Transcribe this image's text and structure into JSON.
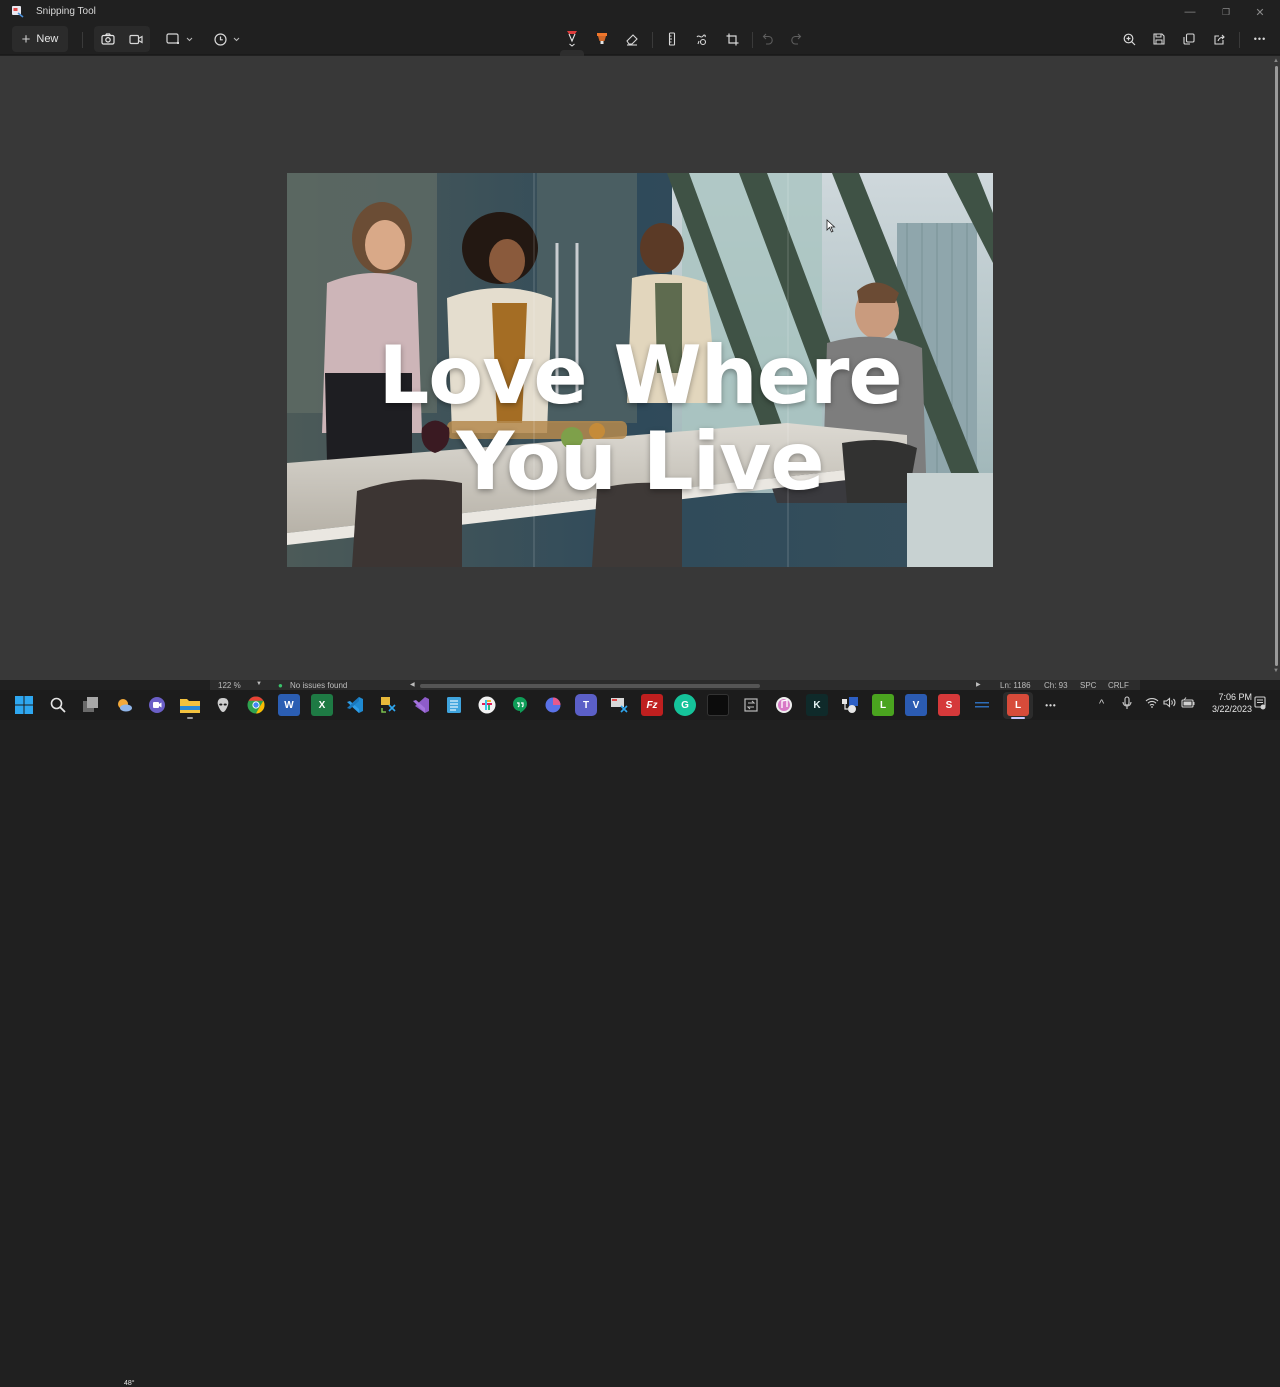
{
  "window": {
    "title": "Snipping Tool",
    "controls": {
      "minimize": "—",
      "maximize": "❐",
      "close": "✕"
    }
  },
  "toolbar": {
    "new_label": "New",
    "new_icon": "plus-icon",
    "capture_modes": [
      {
        "name": "snip-mode",
        "icon": "camera-icon",
        "active": true
      },
      {
        "name": "record-mode",
        "icon": "video-camera-icon",
        "active": false
      }
    ],
    "shape_icon": "rectangle-snip-icon",
    "delay_icon": "clock-icon",
    "markup_tools": [
      {
        "name": "ballpoint-pen",
        "icon": "pen-icon",
        "color": "#e03c3c",
        "active": true
      },
      {
        "name": "highlighter",
        "icon": "highlighter-icon",
        "color": "#f0762b",
        "active": false
      },
      {
        "name": "eraser",
        "icon": "eraser-icon",
        "active": false
      },
      {
        "name": "ruler",
        "icon": "ruler-icon",
        "active": false
      },
      {
        "name": "touch-writing",
        "icon": "touch-writing-icon",
        "active": false
      },
      {
        "name": "crop",
        "icon": "crop-icon",
        "active": false
      }
    ],
    "history": [
      {
        "name": "undo",
        "icon": "undo-icon",
        "enabled": false
      },
      {
        "name": "redo",
        "icon": "redo-icon",
        "enabled": false
      }
    ],
    "right_actions": [
      {
        "name": "zoom",
        "icon": "zoom-in-icon"
      },
      {
        "name": "save",
        "icon": "save-icon"
      },
      {
        "name": "copy",
        "icon": "copy-icon"
      },
      {
        "name": "share",
        "icon": "share-icon"
      },
      {
        "name": "more",
        "icon": "more-icon",
        "glyph": "•••"
      }
    ]
  },
  "canvas": {
    "image": {
      "description": "Group of four friends laughing around a kitchen island with food and wine, skyline windows behind",
      "headline_line1": "Love Where",
      "headline_line2": "You Live"
    }
  },
  "editor_status": {
    "zoom": "122 %",
    "issues": "No issues found",
    "line": "Ln: 1186",
    "col": "Ch: 93",
    "indent": "SPC",
    "eol": "CRLF"
  },
  "taskbar": {
    "weather": "48°",
    "apps": [
      {
        "name": "start",
        "icon": "windows-start-icon"
      },
      {
        "name": "search",
        "icon": "search-icon"
      },
      {
        "name": "task-view",
        "icon": "task-view-icon"
      },
      {
        "name": "weather",
        "icon": "weather-icon"
      },
      {
        "name": "teams-chat",
        "icon": "teams-chat-icon"
      },
      {
        "name": "file-explorer",
        "icon": "folder-icon"
      },
      {
        "name": "alienware",
        "icon": "alien-icon"
      },
      {
        "name": "chrome",
        "icon": "chrome-icon"
      },
      {
        "name": "word",
        "icon": "word-icon",
        "glyph": "W"
      },
      {
        "name": "excel",
        "icon": "excel-icon",
        "glyph": "X"
      },
      {
        "name": "vscode",
        "icon": "vscode-icon"
      },
      {
        "name": "snip-sketch",
        "icon": "snip-sketch-icon"
      },
      {
        "name": "visual-studio",
        "icon": "visual-studio-icon"
      },
      {
        "name": "notepad",
        "icon": "notepad-icon"
      },
      {
        "name": "slack",
        "icon": "slack-icon"
      },
      {
        "name": "hangouts",
        "icon": "hangouts-icon"
      },
      {
        "name": "copilot",
        "icon": "copilot-icon"
      },
      {
        "name": "teams",
        "icon": "teams-icon",
        "glyph": "T"
      },
      {
        "name": "remote-desktop",
        "icon": "remote-desktop-icon"
      },
      {
        "name": "filezilla",
        "icon": "filezilla-icon",
        "glyph": "Fz"
      },
      {
        "name": "grammarly",
        "icon": "grammarly-icon",
        "glyph": "G"
      },
      {
        "name": "terminal",
        "icon": "terminal-icon"
      },
      {
        "name": "snipping-tool",
        "icon": "snipping-tool-icon"
      },
      {
        "name": "itunes",
        "icon": "itunes-icon"
      },
      {
        "name": "app-k",
        "icon": "k-app-icon",
        "glyph": "K"
      },
      {
        "name": "network-tool",
        "icon": "network-icon"
      },
      {
        "name": "app-l-green",
        "icon": "l-green-icon",
        "glyph": "L"
      },
      {
        "name": "visio",
        "icon": "visio-icon",
        "glyph": "V"
      },
      {
        "name": "app-s-red",
        "icon": "s-red-icon",
        "glyph": "S"
      },
      {
        "name": "app-blue",
        "icon": "blue-app-icon"
      },
      {
        "name": "app-l-red",
        "icon": "l-red-icon",
        "glyph": "L"
      },
      {
        "name": "overflow",
        "icon": "more-icon",
        "glyph": "•••"
      }
    ],
    "tray": {
      "chevron": "^",
      "mic_icon": "microphone-icon",
      "wifi_icon": "wifi-icon",
      "volume_icon": "volume-icon",
      "battery_icon": "battery-icon",
      "time": "7:06 PM",
      "date": "3/22/2023",
      "notification_icon": "notification-icon"
    }
  }
}
